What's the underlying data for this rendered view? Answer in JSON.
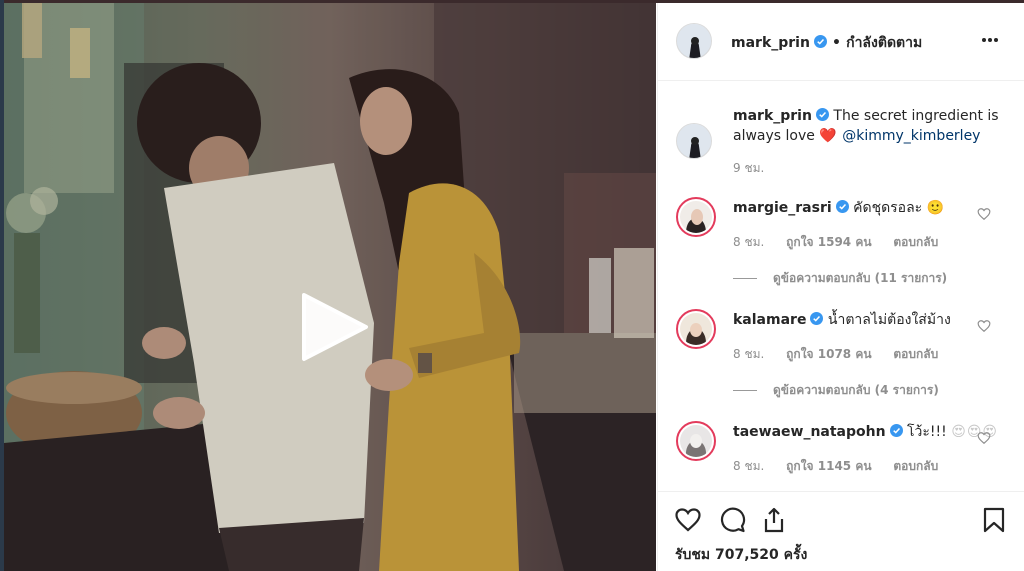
{
  "header": {
    "username": "mark_prin",
    "separator": "•",
    "follow_status": "กำลังติดตาม"
  },
  "caption": {
    "username": "mark_prin",
    "text": "The secret ingredient is always love",
    "emoji_faint": "❤️",
    "mention": "@kimmy_kimberley",
    "time": "9 ชม."
  },
  "comments": [
    {
      "username": "margie_rasri",
      "text": "คัดชุดรอละ",
      "text_faint": "🙂",
      "time": "8 ชม.",
      "likes": "ถูกใจ 1594 คน",
      "reply_label": "ตอบกลับ",
      "view_replies": "ดูข้อความตอบกลับ (11 รายการ)"
    },
    {
      "username": "kalamare",
      "text": "น้ำตาลไม่ต้องใส่ม้าง",
      "text_faint": "",
      "time": "8 ชม.",
      "likes": "ถูกใจ 1078 คน",
      "reply_label": "ตอบกลับ",
      "view_replies": "ดูข้อความตอบกลับ (4 รายการ)"
    },
    {
      "username": "taewaew_natapohn",
      "text": "โว้ะ!!!",
      "text_faint": "😍😍😍",
      "time": "8 ชม.",
      "likes": "ถูกใจ 1145 คน",
      "reply_label": "ตอบกลับ",
      "view_replies": ""
    }
  ],
  "footer": {
    "views": "รับชม 707,520 ครั้ง"
  },
  "icons": {
    "verified_color": "#3897f0",
    "like": "heart-icon",
    "comment": "comment-icon",
    "share": "share-icon",
    "save": "bookmark-icon",
    "play": "play-icon",
    "more": "more-options-icon"
  }
}
